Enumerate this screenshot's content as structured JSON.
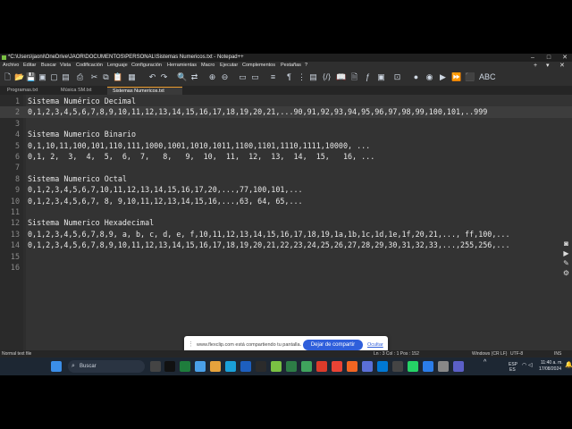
{
  "window": {
    "title": "*C:\\Users\\jaoni\\OneDrive\\JAOR\\DOCUMENTOS\\PERSONAL\\Sistemas Numericos.txt - Notepad++"
  },
  "menu": [
    "Archivo",
    "Editar",
    "Buscar",
    "Vista",
    "Codificación",
    "Lenguaje",
    "Configuración",
    "Herramientas",
    "Macro",
    "Ejecutar",
    "Complementos",
    "Pestañas",
    "?"
  ],
  "tabs": [
    {
      "label": "Programas.txt"
    },
    {
      "label": "Música SM.txt"
    },
    {
      "label": "Sistemas Numericos.txt"
    }
  ],
  "editor": {
    "lines": [
      "Sistema Numérico Decimal",
      "0,1,2,3,4,5,6,7,8,9,10,11,12,13,14,15,16,17,18,19,20,21,...90,91,92,93,94,95,96,97,98,99,100,101,..999",
      "",
      "Sistema Numerico Binario",
      "0,1,10,11,100,101,110,111,1000,1001,1010,1011,1100,1101,1110,1111,10000, ...",
      "0,1, 2,  3,  4,  5,  6,  7,   8,   9,  10,  11,  12,  13,  14,  15,   16, ...",
      "",
      "Sistema Numerico Octal",
      "0,1,2,3,4,5,6,7,10,11,12,13,14,15,16,17,20,...,77,100,101,...",
      "0,1,2,3,4,5,6,7, 8, 9,10,11,12,13,14,15,16,...,63, 64, 65,...",
      "",
      "Sistema Numerico Hexadecimal",
      "0,1,2,3,4,5,6,7,8,9, a, b, c, d, e, f,10,11,12,13,14,15,16,17,18,19,1a,1b,1c,1d,1e,1f,20,21,..., ff,100,...",
      "0,1,2,3,4,5,6,7,8,9,10,11,12,13,14,15,16,17,18,19,20,21,22,23,24,25,26,27,28,29,30,31,32,33,...,255,256,...",
      "",
      ""
    ]
  },
  "status": {
    "type": "Normal text file",
    "position": "Ln : 3    Col : 1    Pos : 152",
    "eol": "Windows (CR LF)",
    "encoding": "UTF-8",
    "mode": "INS"
  },
  "share_bar": {
    "message": "www.flexclip.com está compartiendo tu pantalla.",
    "stop_label": "Dejar de compartir",
    "hide_label": "Ocultar"
  },
  "taskbar": {
    "search_placeholder": "Buscar",
    "lang": "ESP",
    "lang2": "ES",
    "time": "11:40 a. m.",
    "date": "17/08/2024"
  },
  "colors": {
    "accent": "#2f5fdb",
    "editor_bg": "#333333",
    "active_line": "#3d3d3d"
  }
}
